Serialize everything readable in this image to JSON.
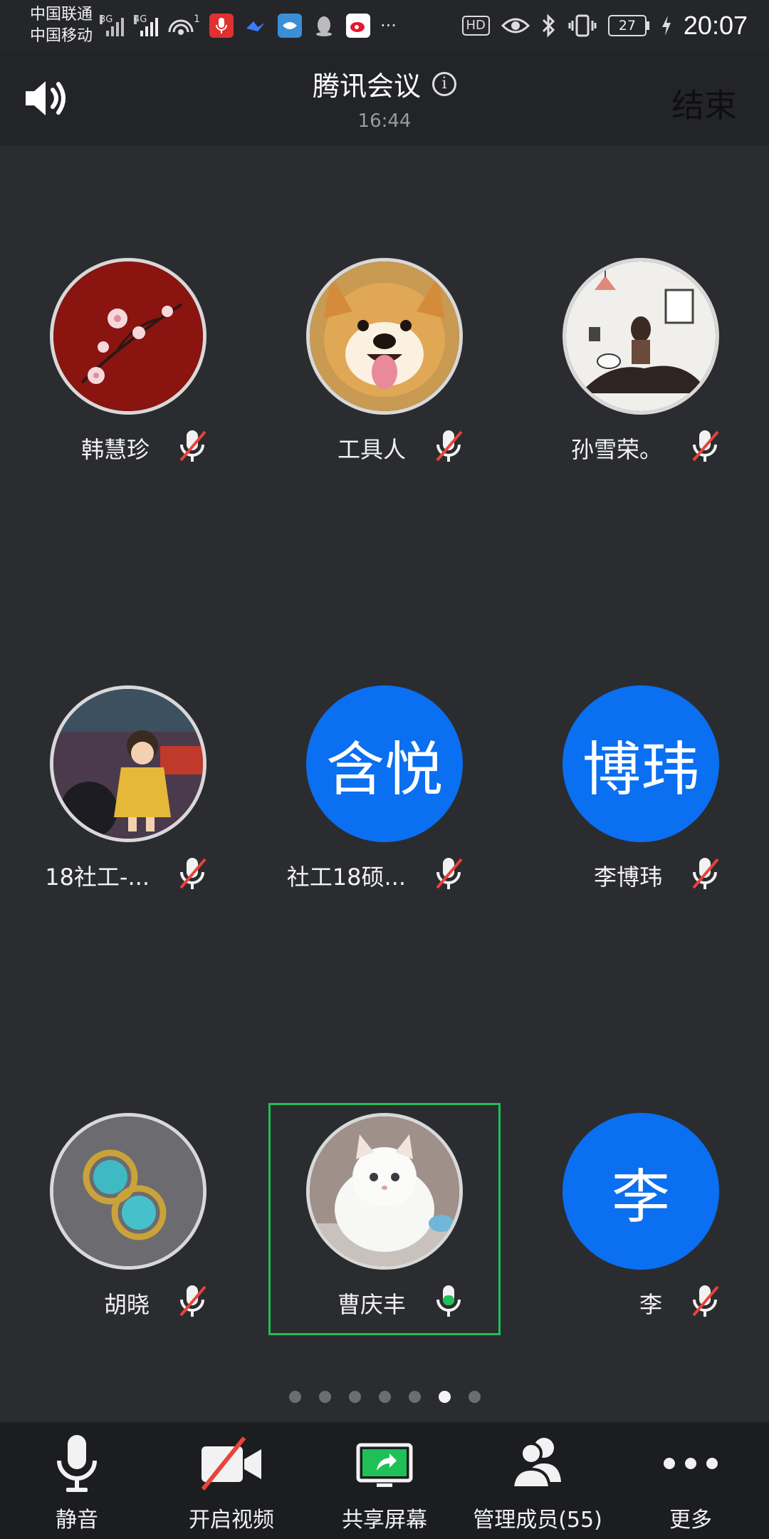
{
  "status_bar": {
    "carrier_1": "中国联通",
    "carrier_2": "中国移动",
    "net_1": "3G",
    "net_2": "4G",
    "hotspot_count": "1",
    "hd": "HD",
    "battery": "27",
    "time": "20:07"
  },
  "header": {
    "title": "腾讯会议",
    "timer": "16:44",
    "end_label": "结束",
    "info_glyph": "i"
  },
  "participants": [
    {
      "name": "韩慧珍",
      "avatar": "photo-plum-blossom",
      "mic": "muted"
    },
    {
      "name": "工具人",
      "avatar": "photo-shiba-dog",
      "mic": "muted"
    },
    {
      "name": "孙雪荣。",
      "avatar": "photo-illustration-girl",
      "mic": "muted"
    },
    {
      "name": "18社工-...",
      "avatar": "photo-cartoon-child",
      "mic": "muted"
    },
    {
      "name": "社工18硕...",
      "avatar": "initials",
      "initials": "含悦",
      "mic": "muted"
    },
    {
      "name": "李博玮",
      "avatar": "initials",
      "initials": "博玮",
      "mic": "muted"
    },
    {
      "name": "胡晓",
      "avatar": "photo-turquoise-earrings",
      "mic": "muted"
    },
    {
      "name": "曹庆丰",
      "avatar": "photo-white-kitten",
      "mic": "speaking",
      "active": true
    },
    {
      "name": "李",
      "avatar": "initials",
      "initials": "李",
      "mic": "muted"
    }
  ],
  "pagination": {
    "total": 7,
    "current": 6
  },
  "toolbar": {
    "mute_label": "静音",
    "video_label": "开启视频",
    "share_label": "共享屏幕",
    "members_label": "管理成员(55)",
    "more_label": "更多"
  },
  "colors": {
    "background": "#2b2c30",
    "accent_blue": "#0a6ff0",
    "active_green": "#20c058",
    "muted_red": "#e8433a"
  }
}
